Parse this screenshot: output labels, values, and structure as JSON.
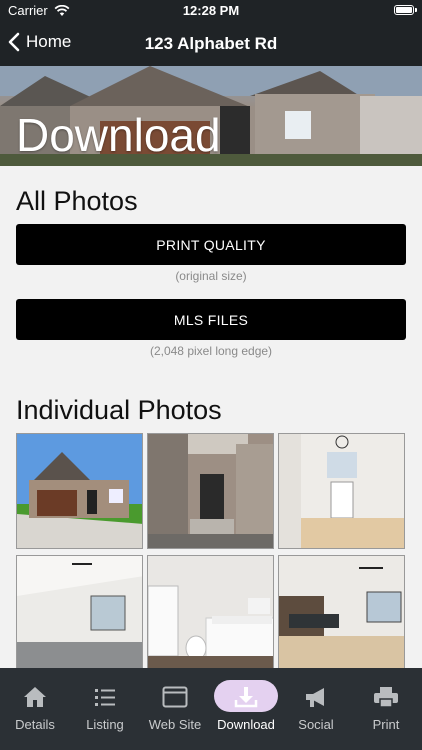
{
  "status": {
    "carrier": "Carrier",
    "time": "12:28 PM"
  },
  "nav": {
    "back_label": "Home",
    "title": "123 Alphabet Rd"
  },
  "hero": {
    "heading": "Download"
  },
  "all_photos": {
    "title": "All Photos",
    "print_label": "PRINT QUALITY",
    "print_caption": "(original size)",
    "mls_label": "MLS FILES",
    "mls_caption": "(2,048 pixel long edge)"
  },
  "individual": {
    "title": "Individual Photos"
  },
  "tabs": [
    {
      "label": "Details",
      "icon": "home-icon"
    },
    {
      "label": "Listing",
      "icon": "list-icon"
    },
    {
      "label": "Web Site",
      "icon": "browser-icon"
    },
    {
      "label": "Download",
      "icon": "download-icon"
    },
    {
      "label": "Social",
      "icon": "megaphone-icon"
    },
    {
      "label": "Print",
      "icon": "printer-icon"
    }
  ],
  "colors": {
    "bar": "#1f2326",
    "tabbar": "#2b3035",
    "active_pill": "#e4d1f0",
    "button": "#000000"
  }
}
